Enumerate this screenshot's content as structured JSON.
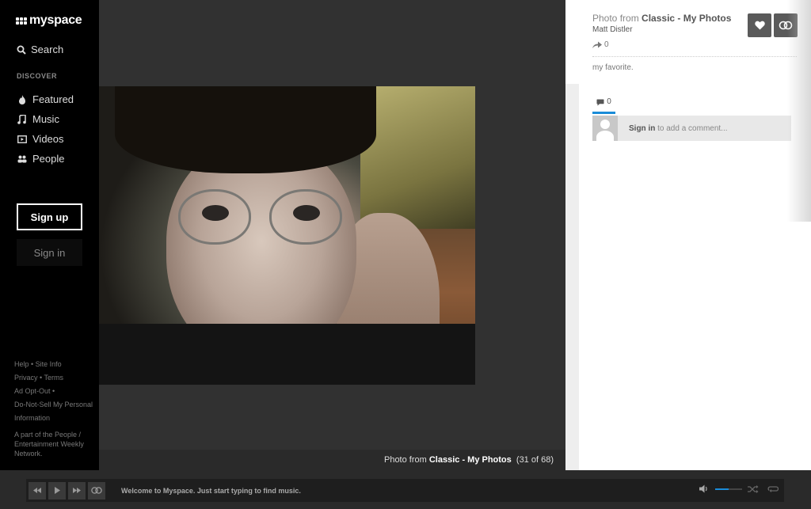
{
  "brand": {
    "name": "myspace"
  },
  "sidebar": {
    "search_label": "Search",
    "section_label": "DISCOVER",
    "items": [
      {
        "label": "Featured",
        "icon": "flame-icon"
      },
      {
        "label": "Music",
        "icon": "music-note-icon"
      },
      {
        "label": "Videos",
        "icon": "video-icon"
      },
      {
        "label": "People",
        "icon": "people-icon"
      }
    ],
    "signup_label": "Sign up",
    "signin_label": "Sign in",
    "footer": {
      "help": "Help",
      "site_info": "Site Info",
      "privacy": "Privacy",
      "terms": "Terms",
      "ad_opt_out": "Ad Opt-Out",
      "do_not_sell": "Do-Not-Sell My Personal Information",
      "network": "A part of the People / Entertainment Weekly Network."
    }
  },
  "viewer": {
    "caption_prefix": "Photo from",
    "caption_album": "Classic - My Photos",
    "caption_count": "(31 of 68)"
  },
  "panel": {
    "title_prefix": "Photo from",
    "title_album": "Classic - My Photos",
    "author": "Matt Distler",
    "share_count": "0",
    "description": "my favorite.",
    "comment_count": "0",
    "comment_signin": "Sign in",
    "comment_prompt": "to add a comment..."
  },
  "player": {
    "message": "Welcome to Myspace. Just start typing to find music.",
    "volume_fraction": 0.5
  },
  "colors": {
    "accent": "#1a8cd8",
    "sidebar_bg": "#000000",
    "viewer_bg": "#313131"
  }
}
